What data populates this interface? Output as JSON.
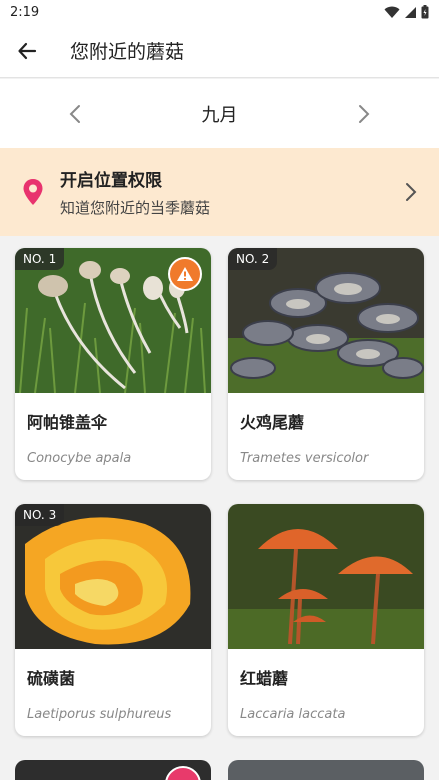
{
  "status_bar": {
    "time": "2:19"
  },
  "app_bar": {
    "title": "您附近的蘑菇"
  },
  "month_selector": {
    "label": "九月"
  },
  "location_prompt": {
    "title": "开启位置权限",
    "subtitle": "知道您附近的当季蘑菇",
    "accent_color": "#e8336e",
    "background_color": "#fde9d0"
  },
  "mushrooms": [
    {
      "rank": "NO. 1",
      "name": "阿帕锥盖伞",
      "latin": "Conocybe apala",
      "warning": true,
      "warning_color": "#f07a2b"
    },
    {
      "rank": "NO. 2",
      "name": "火鸡尾蘑",
      "latin": "Trametes versicolor",
      "warning": false
    },
    {
      "rank": "NO. 3",
      "name": "硫磺菌",
      "latin": "Laetiporus sulphureus",
      "warning": false
    },
    {
      "rank": "",
      "name": "红蜡蘑",
      "latin": "Laccaria laccata",
      "warning": false
    }
  ]
}
